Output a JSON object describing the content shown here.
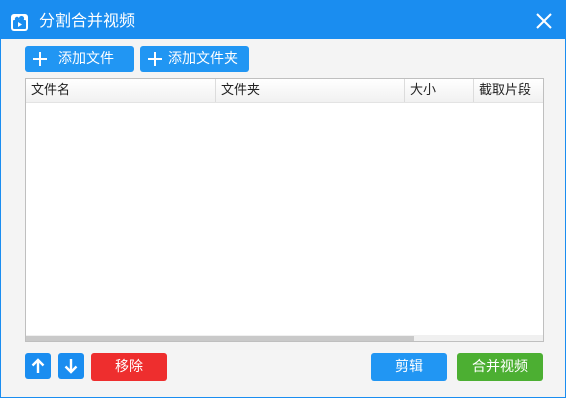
{
  "window": {
    "title": "分割合并视频",
    "app_icon": "app-logo-icon",
    "close_icon": "close-icon"
  },
  "toolbar": {
    "add_file_label": "添加文件",
    "add_folder_label": "添加文件夹"
  },
  "table": {
    "columns": [
      "文件名",
      "文件夹",
      "大小",
      "截取片段"
    ],
    "rows": []
  },
  "footer": {
    "move_up_icon": "arrow-up-icon",
    "move_down_icon": "arrow-down-icon",
    "remove_label": "移除",
    "edit_label": "剪辑",
    "merge_label": "合并视频"
  },
  "colors": {
    "titlebar": "#1a8df0",
    "primary_button": "#2196f3",
    "remove_button": "#ee2e2e",
    "merge_button": "#4caf32"
  }
}
